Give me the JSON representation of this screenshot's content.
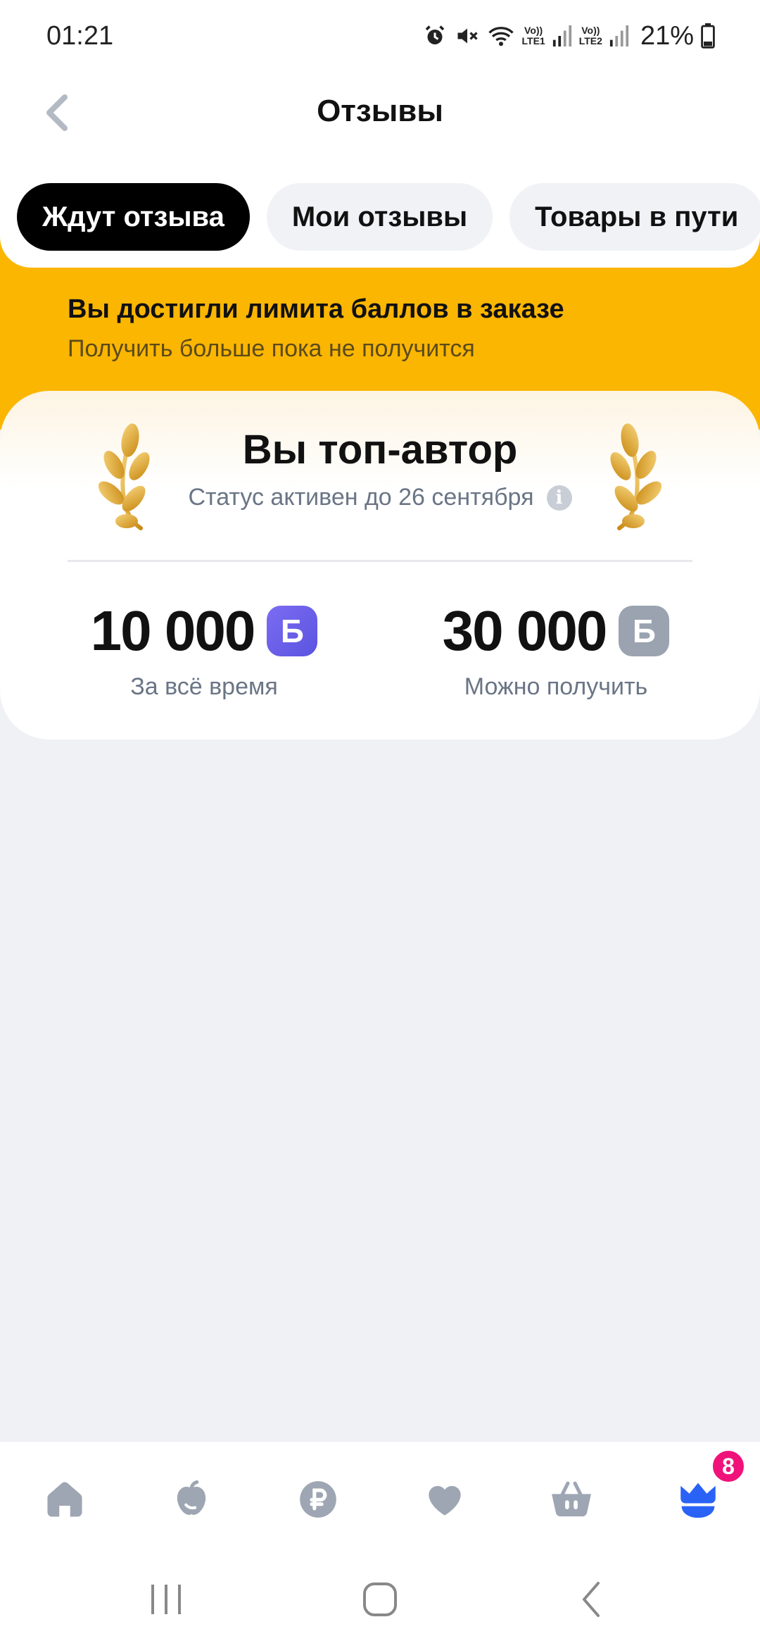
{
  "status_bar": {
    "time": "01:21",
    "sim1": "LTE1",
    "sim2": "LTE2",
    "volte": "Vo))",
    "battery": "21%"
  },
  "header": {
    "title": "Отзывы"
  },
  "tabs": [
    {
      "label": "Ждут отзыва",
      "active": true
    },
    {
      "label": "Мои отзывы",
      "active": false
    },
    {
      "label": "Товары в пути",
      "active": false
    }
  ],
  "banner": {
    "title": "Вы достигли лимита баллов в заказе",
    "subtitle": "Получить больше пока не получится"
  },
  "author_card": {
    "title": "Вы топ-автор",
    "status": "Статус активен до 26 сентября",
    "stats": [
      {
        "value": "10 000",
        "badge": "Б",
        "label": "За всё время",
        "badge_color": "#6a5fe8"
      },
      {
        "value": "30 000",
        "badge": "Б",
        "label": "Можно получить",
        "badge_color": "#9aa3af"
      }
    ]
  },
  "bottom_nav": {
    "items": [
      "home-icon",
      "catalog-icon",
      "finance-icon",
      "favorites-icon",
      "cart-icon",
      "profile-icon"
    ],
    "badge_count": "8",
    "active_color": "#2a62f5",
    "inactive_color": "#9ea6b3"
  },
  "colors": {
    "accent_yellow": "#fbb602",
    "background": "#f0f1f5"
  }
}
